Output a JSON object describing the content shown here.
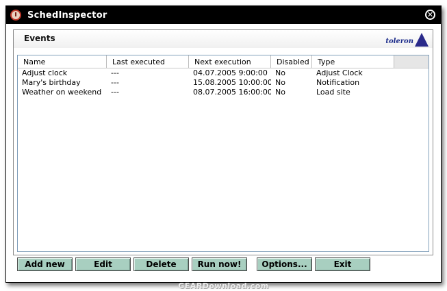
{
  "window": {
    "title": "SchedInspector",
    "app_icon": "clock-icon",
    "close_icon": "close-icon",
    "close_glyph": "✕"
  },
  "panel": {
    "title": "Events",
    "logo_text": "toleron"
  },
  "table": {
    "columns": [
      "Name",
      "Last executed",
      "Next execution",
      "Disabled",
      "Type"
    ],
    "rows": [
      [
        "Adjust clock",
        "---",
        "04.07.2005 9:00:00",
        "No",
        "Adjust Clock"
      ],
      [
        "Mary's birthday",
        "---",
        "15.08.2005 10:00:00",
        "No",
        "Notification"
      ],
      [
        "Weather on weekend",
        "---",
        "08.07.2005 16:00:00",
        "No",
        "Load site"
      ]
    ]
  },
  "buttons": {
    "add_new": "Add new",
    "edit": "Edit",
    "delete": "Delete",
    "run_now": "Run now!",
    "options": "Options...",
    "exit": "Exit"
  },
  "watermark": "GEARDownload.com",
  "colors": {
    "titlebar": "#000000",
    "button_face": "#a8cfc0",
    "logo": "#1a2a8a"
  }
}
